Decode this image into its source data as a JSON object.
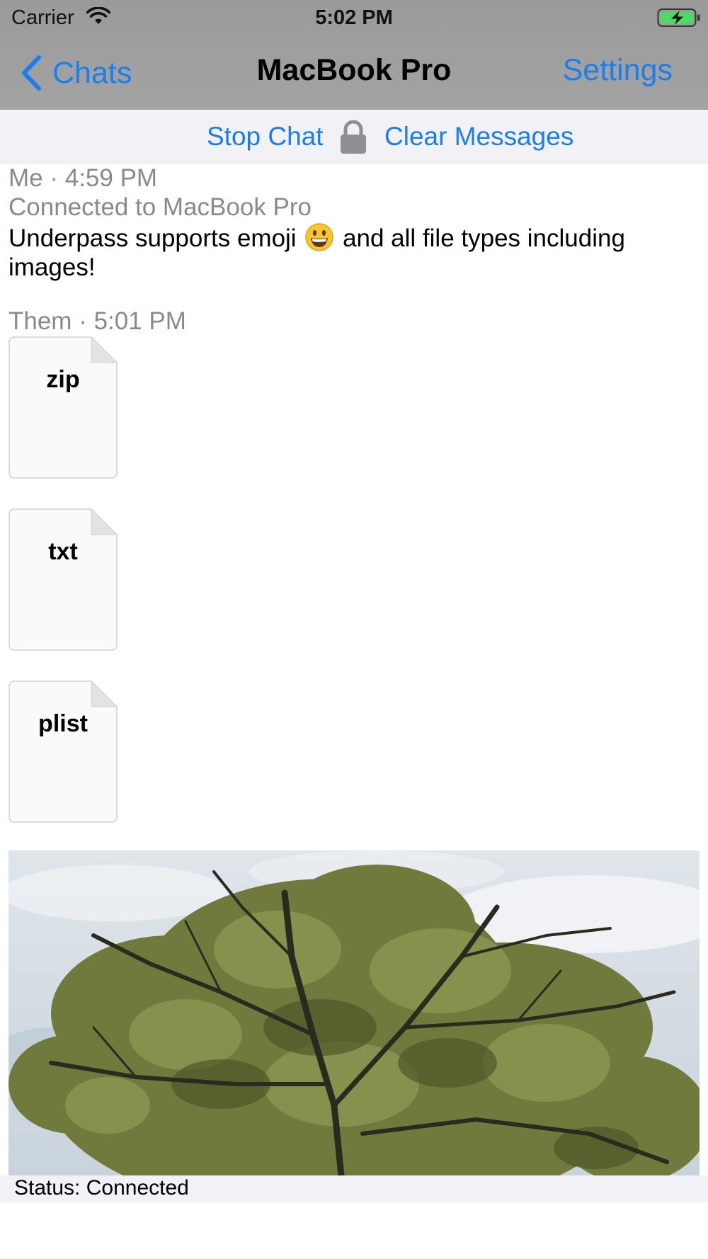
{
  "status_bar": {
    "carrier": "Carrier",
    "time": "5:02 PM",
    "wifi_icon": "wifi-icon",
    "battery_icon": "battery-charging-icon"
  },
  "nav": {
    "back_label": "Chats",
    "back_icon": "chevron-left-icon",
    "title": "MacBook Pro",
    "settings_label": "Settings"
  },
  "toolbar": {
    "stop_chat_label": "Stop Chat",
    "lock_icon": "lock-icon",
    "clear_messages_label": "Clear Messages"
  },
  "messages": [
    {
      "sender_time": "Me · 4:59 PM",
      "note": "Connected to MacBook Pro",
      "text_before": "Underpass supports emoji",
      "emoji": "grinning-face",
      "text_after": "and all file types including images!"
    },
    {
      "sender_time": "Them · 5:01 PM",
      "files": [
        {
          "ext": "zip"
        },
        {
          "ext": "txt"
        },
        {
          "ext": "plist"
        }
      ],
      "image": "tree-photo"
    }
  ],
  "footer": {
    "status": "Status: Connected"
  },
  "colors": {
    "accent": "#1a7ef0",
    "nav_background": "#a0a0a0",
    "toolbar_background": "#f1f1f6",
    "secondary_text": "#8a8a8e",
    "battery_fill": "#4cd964"
  }
}
